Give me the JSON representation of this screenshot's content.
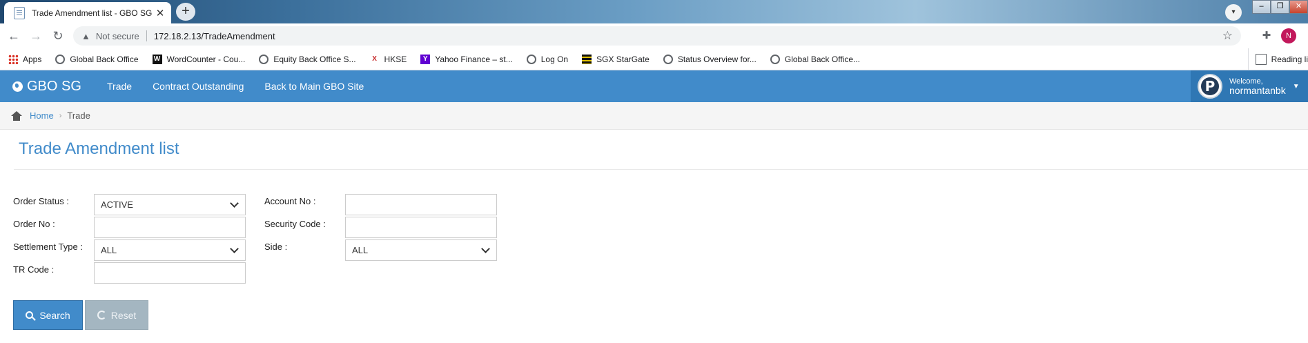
{
  "browser": {
    "tab_title": "Trade Amendment list - GBO SG",
    "tab_close": "✕",
    "new_tab": "+",
    "not_secure": "Not secure",
    "url": "172.18.2.13/TradeAmendment",
    "profile_initial": "N",
    "bookmarks": [
      {
        "label": "Apps",
        "icon": "apps-icon"
      },
      {
        "label": "Global Back Office",
        "icon": "globe-icon"
      },
      {
        "label": "WordCounter - Cou...",
        "icon": "wordcounter-icon"
      },
      {
        "label": "Equity Back Office S...",
        "icon": "globe-icon"
      },
      {
        "label": "HKSE",
        "icon": "hkse-icon"
      },
      {
        "label": "Yahoo Finance – st...",
        "icon": "yahoo-icon"
      },
      {
        "label": "Log On",
        "icon": "globe-icon"
      },
      {
        "label": "SGX StarGate",
        "icon": "sgx-icon"
      },
      {
        "label": "Status Overview for...",
        "icon": "globe-icon"
      },
      {
        "label": "Global Back Office...",
        "icon": "globe-icon"
      }
    ],
    "reading_list": "Reading li"
  },
  "app": {
    "brand": "GBO SG",
    "nav": [
      "Trade",
      "Contract Outstanding",
      "Back to Main GBO Site"
    ],
    "user": {
      "welcome": "Welcome,",
      "name": "normantanbk",
      "avatar_letter": "P"
    },
    "accent": "#418bca"
  },
  "breadcrumb": {
    "home": "Home",
    "current": "Trade"
  },
  "page": {
    "title": "Trade Amendment list"
  },
  "form": {
    "order_status": {
      "label": "Order Status :",
      "value": "ACTIVE"
    },
    "order_no": {
      "label": "Order No :",
      "value": ""
    },
    "settlement_type": {
      "label": "Settlement Type :",
      "value": "ALL"
    },
    "tr_code": {
      "label": "TR Code :",
      "value": ""
    },
    "account_no": {
      "label": "Account No :",
      "value": ""
    },
    "security_code": {
      "label": "Security Code :",
      "value": ""
    },
    "side": {
      "label": "Side :",
      "value": "ALL"
    }
  },
  "buttons": {
    "search": "Search",
    "reset": "Reset"
  }
}
